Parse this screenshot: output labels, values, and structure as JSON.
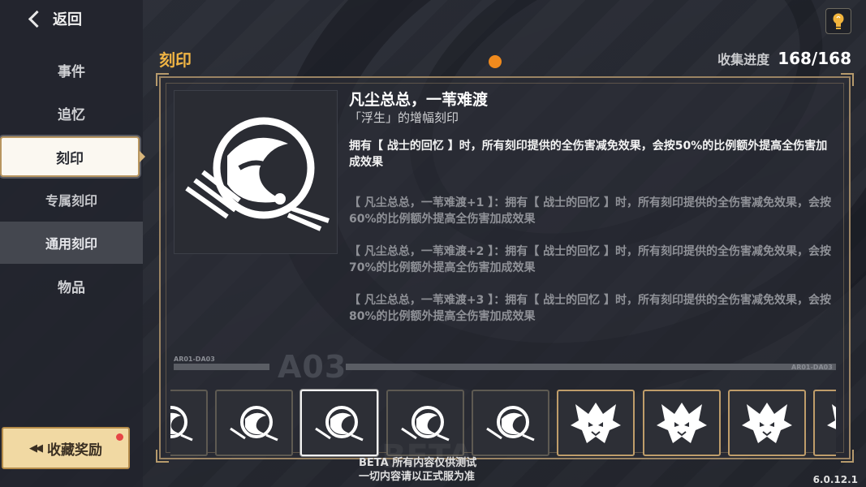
{
  "nav": {
    "back_label": "返回",
    "items": [
      {
        "label": "事件"
      },
      {
        "label": "追忆"
      },
      {
        "label": "刻印"
      },
      {
        "label": "专属刻印"
      },
      {
        "label": "通用刻印"
      },
      {
        "label": "物品"
      }
    ],
    "reward_label": "收藏奖励"
  },
  "header": {
    "section_title": "刻印",
    "progress_label": "收集进度",
    "progress_value": "168/168"
  },
  "stigmata": {
    "name": "凡尘总总，一苇难渡",
    "subtitle": "「浮生」的增幅刻印",
    "description": "拥有【 战士的回忆 】时，所有刻印提供的全伤害减免效果，会按50%的比例额外提高全伤害加成效果",
    "upgrades": [
      "【 凡尘总总，一苇难渡+1 】：拥有【 战士的回忆 】时，所有刻印提供的全伤害减免效果，会按60%的比例额外提高全伤害加成效果",
      "【 凡尘总总，一苇难渡+2 】：拥有【 战士的回忆 】时，所有刻印提供的全伤害减免效果，会按70%的比例额外提高全伤害加成效果",
      "【 凡尘总总，一苇难渡+3 】：拥有【 战士的回忆 】时，所有刻印提供的全伤害减免效果，会按80%的比例额外提高全伤害加成效果"
    ]
  },
  "divider": {
    "code_left": "AR01-DA03",
    "big": "A03",
    "code_right": "AR01-DA03"
  },
  "cards": [
    {
      "icon": "swirl-stigmata-icon"
    },
    {
      "icon": "swirl-stigmata-icon"
    },
    {
      "icon": "swirl-stigmata-icon"
    },
    {
      "icon": "swirl-stigmata-icon"
    },
    {
      "icon": "swirl-stigmata-icon"
    },
    {
      "icon": "wolf-stigmata-icon"
    },
    {
      "icon": "wolf-stigmata-icon"
    },
    {
      "icon": "wolf-stigmata-icon"
    },
    {
      "icon": "wolf-stigmata-icon"
    }
  ],
  "footer": {
    "beta_line1": "BETA 所有内容仅供测试",
    "beta_line2": "一切内容请以正式服为准",
    "beta_watermark": "BETA",
    "version": "6.0.12.1"
  },
  "colors": {
    "accent_gold": "#f0b444",
    "frame_border": "#9b8463",
    "page_dot": "#f08a1d",
    "badge_red": "#e64545"
  }
}
